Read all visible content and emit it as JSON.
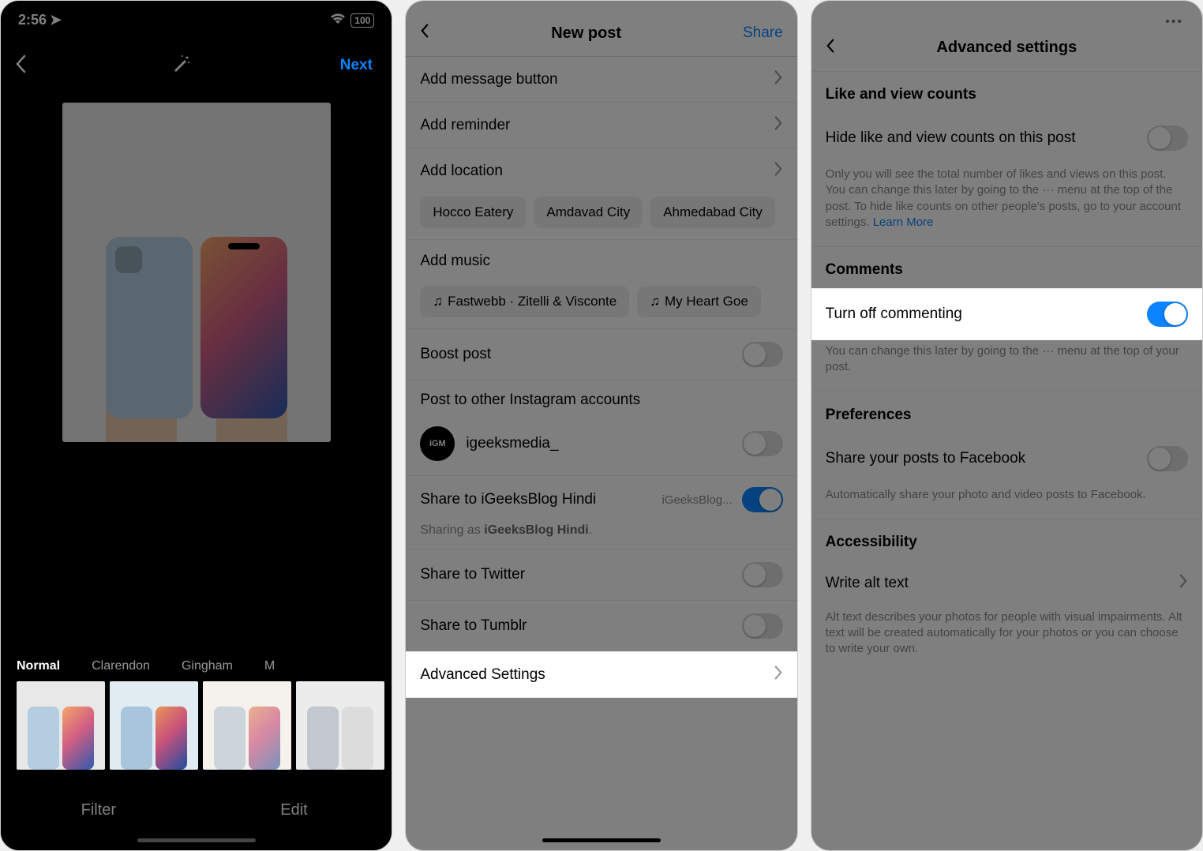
{
  "panel1": {
    "status": {
      "time": "2:56",
      "battery": "100"
    },
    "nav": {
      "next": "Next"
    },
    "filters": {
      "labels": [
        "Normal",
        "Clarendon",
        "Gingham",
        "M"
      ]
    },
    "tabs": {
      "filter": "Filter",
      "edit": "Edit"
    }
  },
  "panel2": {
    "nav": {
      "title": "New post",
      "share": "Share"
    },
    "rows": {
      "add_message_button": "Add message button",
      "add_reminder": "Add reminder",
      "add_location": "Add location",
      "add_music": "Add music",
      "boost_post": "Boost post",
      "post_to_other": "Post to other Instagram accounts",
      "account_handle": "igeeksmedia_",
      "share_hindi": "Share to iGeeksBlog Hindi",
      "share_hindi_sub": "iGeeksBlog...",
      "sharing_as_prefix": "Sharing as ",
      "sharing_as_bold": "iGeeksBlog Hindi",
      "share_twitter": "Share to Twitter",
      "share_tumblr": "Share to Tumblr",
      "advanced_settings": "Advanced Settings"
    },
    "location_chips": [
      "Hocco Eatery",
      "Amdavad City",
      "Ahmedabad City"
    ],
    "music_chips": [
      "Fastwebb · Zitelli & Visconte",
      "My Heart Goe"
    ]
  },
  "panel3": {
    "nav": {
      "title": "Advanced settings"
    },
    "sections": {
      "like_view_header": "Like and view counts",
      "hide_like": "Hide like and view counts on this post",
      "hide_like_desc": "Only you will see the total number of likes and views on this post. You can change this later by going to the ··· menu at the top of the post. To hide like counts on other people's posts, go to your account settings. ",
      "learn_more": "Learn More",
      "comments_header": "Comments",
      "turn_off_commenting": "Turn off commenting",
      "turn_off_desc": "You can change this later by going to the ··· menu at the top of your post.",
      "preferences_header": "Preferences",
      "share_facebook": "Share your posts to Facebook",
      "share_facebook_desc": "Automatically share your photo and video posts to Facebook.",
      "accessibility_header": "Accessibility",
      "write_alt": "Write alt text",
      "write_alt_desc": "Alt text describes your photos for people with visual impairments. Alt text will be created automatically for your photos or you can choose to write your own."
    }
  }
}
